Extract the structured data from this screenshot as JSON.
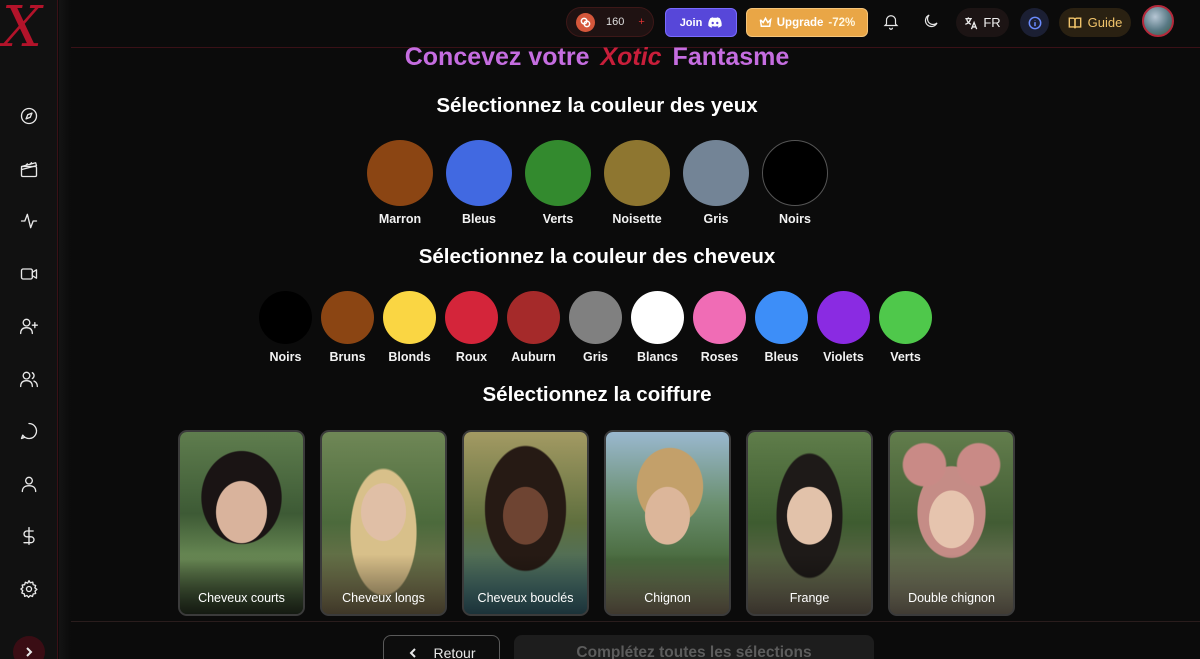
{
  "brand": {
    "logo_letter": "X"
  },
  "sidebar": {
    "items": [
      {
        "icon": "compass-icon"
      },
      {
        "icon": "clapperboard-icon"
      },
      {
        "icon": "activity-icon"
      },
      {
        "icon": "video-icon"
      },
      {
        "icon": "user-plus-icon"
      },
      {
        "icon": "users-icon"
      },
      {
        "icon": "chat-icon"
      },
      {
        "icon": "user-icon"
      },
      {
        "icon": "dollar-icon"
      },
      {
        "icon": "gear-icon"
      }
    ]
  },
  "topbar": {
    "coins": "160",
    "coins_plus": "+",
    "join_label": "Join",
    "upgrade_label": "Upgrade",
    "upgrade_discount": "-72%",
    "language": "FR",
    "guide_label": "Guide"
  },
  "page": {
    "title_prefix": "Concevez votre",
    "title_brand": "Xotic",
    "title_suffix": "Fantasme",
    "eyes_title": "Sélectionnez la couleur des yeux",
    "hair_title": "Sélectionnez la couleur des cheveux",
    "style_title": "Sélectionnez la coiffure"
  },
  "eye_colors": [
    {
      "label": "Marron",
      "color": "#8b4513"
    },
    {
      "label": "Bleus",
      "color": "#4169e1"
    },
    {
      "label": "Verts",
      "color": "#338a2e"
    },
    {
      "label": "Noisette",
      "color": "#8e7630"
    },
    {
      "label": "Gris",
      "color": "#738496"
    },
    {
      "label": "Noirs",
      "color": "#000000"
    }
  ],
  "hair_colors": [
    {
      "label": "Noirs",
      "color": "#000000"
    },
    {
      "label": "Bruns",
      "color": "#8b4513"
    },
    {
      "label": "Blonds",
      "color": "#fad643"
    },
    {
      "label": "Roux",
      "color": "#d4253a"
    },
    {
      "label": "Auburn",
      "color": "#a52a2a"
    },
    {
      "label": "Gris",
      "color": "#808080"
    },
    {
      "label": "Blancs",
      "color": "#ffffff"
    },
    {
      "label": "Roses",
      "color": "#f06cb5"
    },
    {
      "label": "Bleus",
      "color": "#3d8ef8"
    },
    {
      "label": "Violets",
      "color": "#8a2be2"
    },
    {
      "label": "Verts",
      "color": "#4fc84b"
    }
  ],
  "hair_styles": [
    {
      "label": "Cheveux courts"
    },
    {
      "label": "Cheveux longs"
    },
    {
      "label": "Cheveux bouclés"
    },
    {
      "label": "Chignon"
    },
    {
      "label": "Frange"
    },
    {
      "label": "Double chignon"
    }
  ],
  "footer": {
    "back_label": "Retour",
    "complete_label": "Complétez toutes les sélections"
  }
}
